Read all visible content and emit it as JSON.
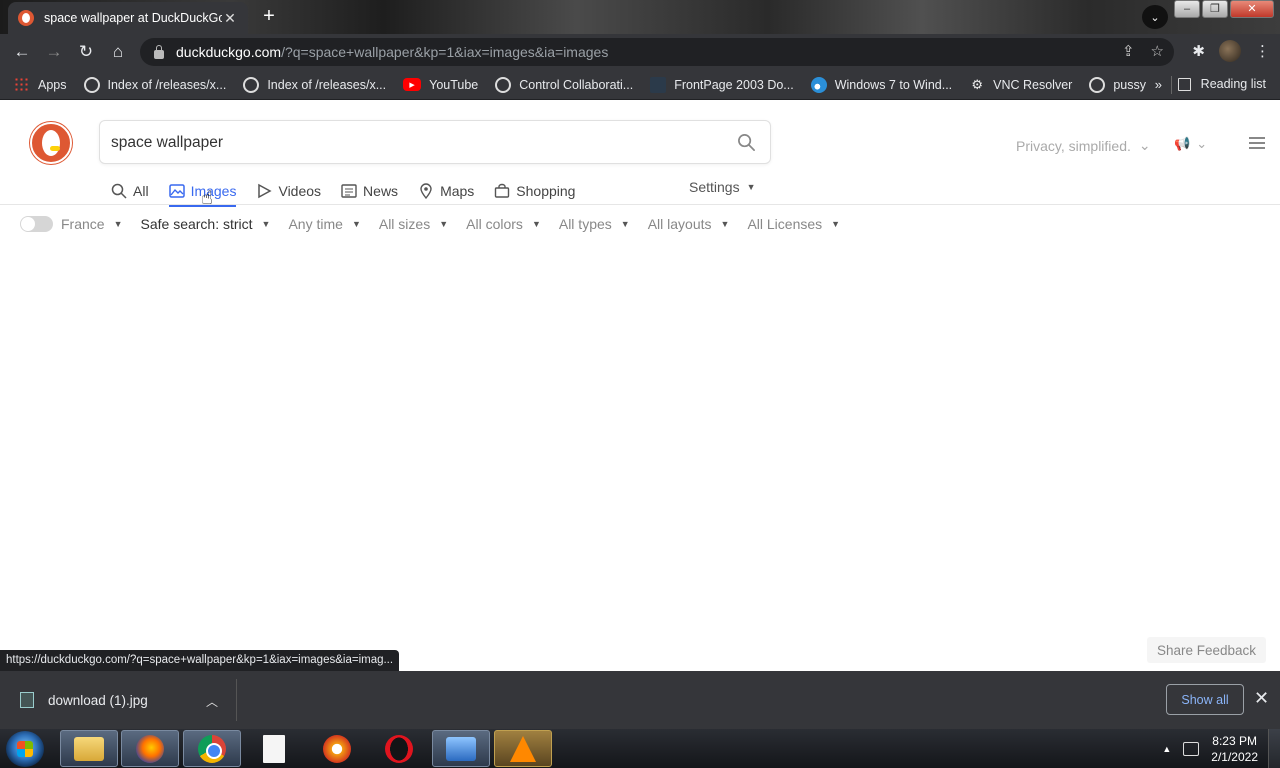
{
  "browser": {
    "tab_title": "space wallpaper at DuckDuckGo",
    "tab_close": "✕",
    "new_tab": "+",
    "url_host": "duckduckgo.com",
    "url_rest": "/?q=space+wallpaper&kp=1&iax=images&ia=images",
    "bookmarks": [
      {
        "label": "Apps",
        "icon": "apps-grid-icon"
      },
      {
        "label": "Index of /releases/x...",
        "icon": "globe-icon"
      },
      {
        "label": "Index of /releases/x...",
        "icon": "globe-icon"
      },
      {
        "label": "YouTube",
        "icon": "youtube-icon"
      },
      {
        "label": "Control Collaborati...",
        "icon": "globe-icon"
      },
      {
        "label": "FrontPage 2003 Do...",
        "icon": "page-icon"
      },
      {
        "label": "Windows 7 to Wind...",
        "icon": "windows-icon"
      },
      {
        "label": "VNC Resolver",
        "icon": "vnc-icon"
      },
      {
        "label": "pussy",
        "icon": "globe-icon"
      }
    ],
    "bookmarks_more": "»",
    "reading_list": "Reading list",
    "status_url": "https://duckduckgo.com/?q=space+wallpaper&kp=1&iax=images&ia=imag..."
  },
  "ddg": {
    "query": "space wallpaper",
    "privacy_label": "Privacy, simplified.",
    "tabs": [
      {
        "label": "All",
        "icon": "search-icon"
      },
      {
        "label": "Images",
        "icon": "image-icon",
        "active": true
      },
      {
        "label": "Videos",
        "icon": "play-icon"
      },
      {
        "label": "News",
        "icon": "newspaper-icon"
      },
      {
        "label": "Maps",
        "icon": "map-pin-icon"
      },
      {
        "label": "Shopping",
        "icon": "shopping-bag-icon"
      }
    ],
    "settings": "Settings",
    "filters": {
      "region": "France",
      "safe_search": "Safe search: strict",
      "time": "Any time",
      "size": "All sizes",
      "color": "All colors",
      "type": "All types",
      "layout": "All layouts",
      "license": "All Licenses"
    },
    "share_feedback": "Share Feedback"
  },
  "downloads": {
    "file_name": "download (1).jpg",
    "show_all": "Show all"
  },
  "taskbar": {
    "time": "8:23 PM",
    "date": "2/1/2022"
  },
  "colors": {
    "ddg_accent": "#de5833",
    "active_tab_blue": "#3969ef",
    "chrome_dark": "#35363a"
  }
}
